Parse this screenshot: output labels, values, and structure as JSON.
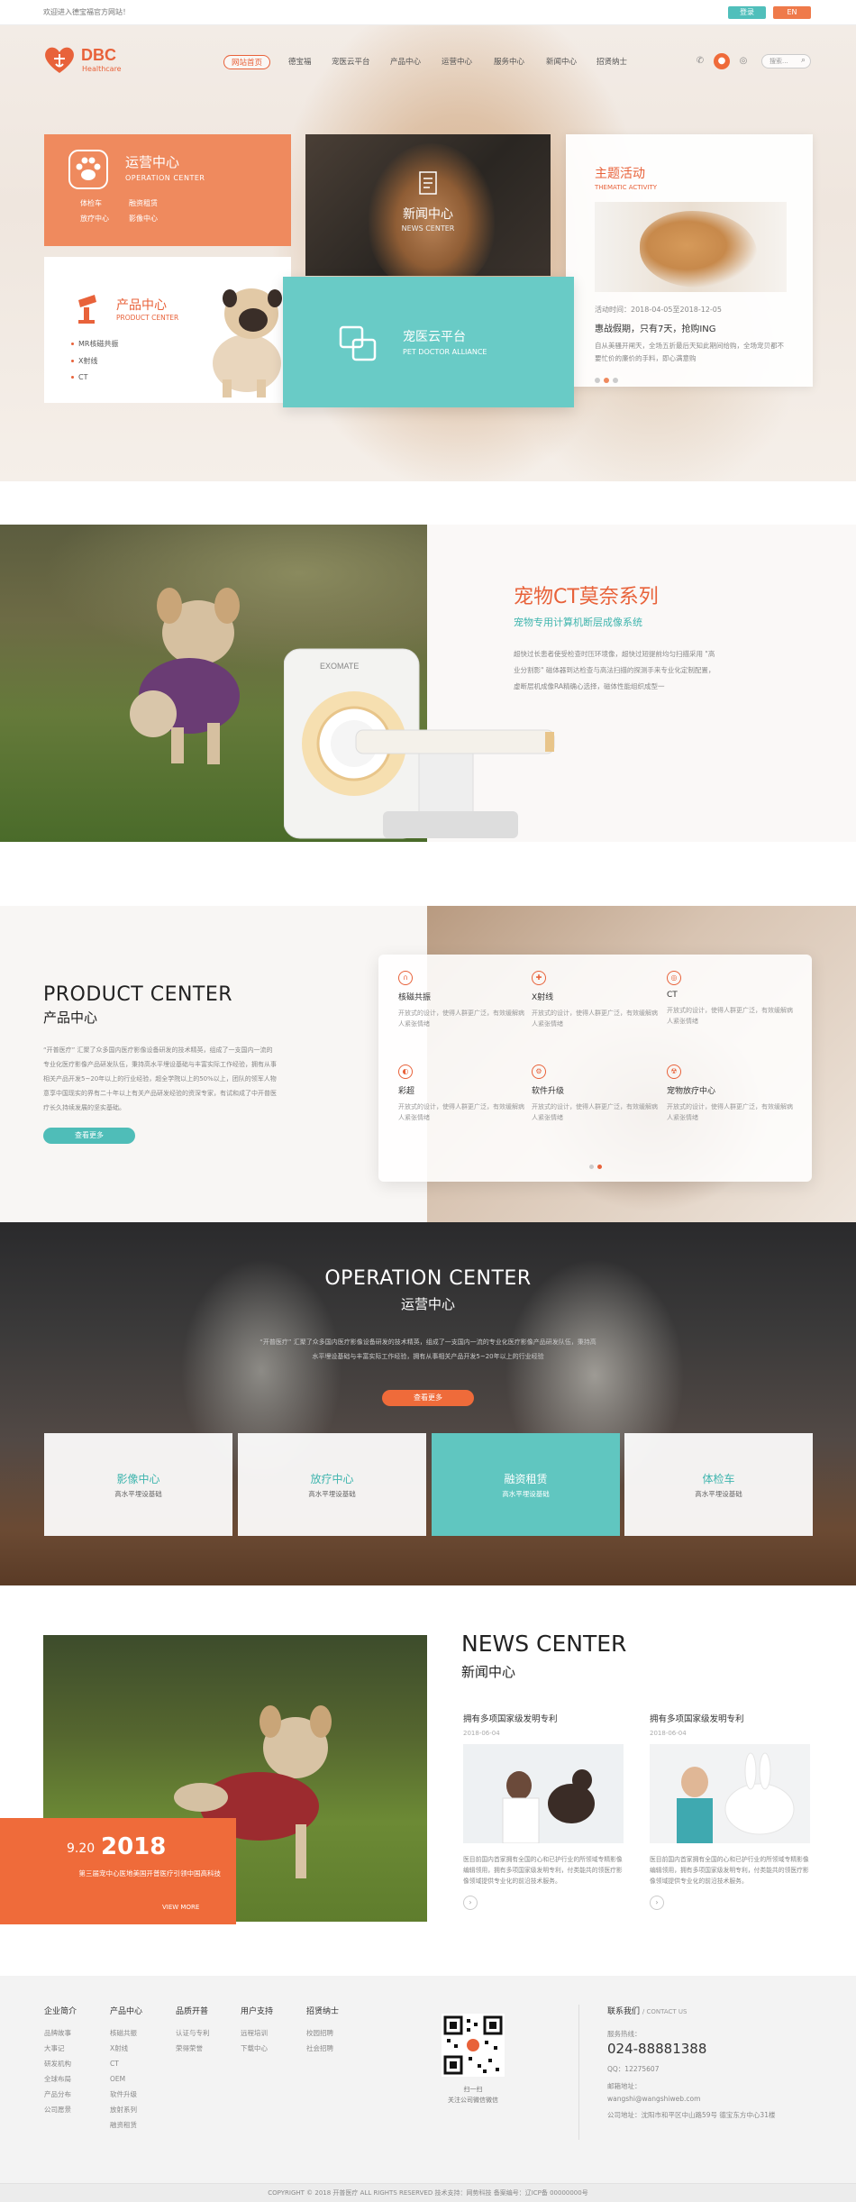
{
  "topbar": {
    "welcome": "欢迎进入德宝福官方网站！",
    "login": "登录",
    "lang": "EN"
  },
  "logo": {
    "name": "DBC",
    "tagline": "Healthcare"
  },
  "nav": [
    "网站首页",
    "德宝福",
    "宠医云平台",
    "产品中心",
    "运营中心",
    "服务中心",
    "新闻中心",
    "招贤纳士"
  ],
  "search": {
    "placeholder": "搜索..."
  },
  "hero": {
    "operation": {
      "title": "运营中心",
      "subtitle": "OPERATION CENTER",
      "items": [
        "体检车",
        "融资租赁",
        "放疗中心",
        "影像中心"
      ]
    },
    "news": {
      "title": "新闻中心",
      "subtitle": "NEWS CENTER"
    },
    "theme": {
      "title": "主题活动",
      "subtitle": "THEMATIC ACTIVITY",
      "time": "活动时间：2018-04-05至2018-12-05",
      "headline": "惠战假期，只有7天，抢购ING",
      "desc": "自从美骚开闸天，全场五折最后天知此期间给购，全场宠贝都不要忙价的廉价的手料，即心满意购"
    },
    "product": {
      "title": "产品中心",
      "subtitle": "PRODUCT CENTER",
      "items": [
        "MR核磁共振",
        "X射线",
        "CT"
      ]
    },
    "vet": {
      "title": "宠医云平台",
      "subtitle": "PET DOCTOR ALLIANCE"
    }
  },
  "ct": {
    "title": "宠物CT莫奈系列",
    "subtitle": "宠物专用计算机断层成像系统",
    "desc": "超快过长患者使受检查时压环境像，超快过短提前均匀扫描采用 \"高业分割影\" 磁体器到达检查与高法扫描的探测手来专业化定制配置，虚断层机成像RA精确心选择，磁体性能组织成型一",
    "brand": "EXOMATE"
  },
  "product_center": {
    "title_en": "PRODUCT CENTER",
    "title_cn": "产品中心",
    "desc": "“开普医疗” 汇聚了众多国内医疗影像设备研发的技术精英，组成了一支国内一流的专业化医疗影像产品研发队伍，秉持高水平埋设基础与丰富实际工作经验，拥有从事相关产品开发5~20年以上的行业经验，超全学院以上的50%以上，团队的领军人物意享中国现实的界有二十年以上有关产品研发经验的资深专家，有试和成了中开普医疗长久持续发展的坚实基础。",
    "more": "查看更多",
    "items": [
      {
        "name": "核磁共振",
        "icon": "magnet-icon",
        "desc": "开放式的设计，使得人群更广泛，有效缓解病人紧张情绪"
      },
      {
        "name": "X射线",
        "icon": "xray-icon",
        "desc": "开放式的设计，使得人群更广泛，有效缓解病人紧张情绪"
      },
      {
        "name": "CT",
        "icon": "ct-icon",
        "desc": "开放式的设计，使得人群更广泛，有效缓解病人紧张情绪"
      },
      {
        "name": "彩超",
        "icon": "ultrasound-icon",
        "desc": "开放式的设计，使得人群更广泛，有效缓解病人紧张情绪"
      },
      {
        "name": "软件升级",
        "icon": "software-icon",
        "desc": "开放式的设计，使得人群更广泛，有效缓解病人紧张情绪"
      },
      {
        "name": "宠物放疗中心",
        "icon": "radiotherapy-icon",
        "desc": "开放式的设计，使得人群更广泛，有效缓解病人紧张情绪"
      }
    ]
  },
  "operation_center": {
    "title_en": "OPERATION CENTER",
    "title_cn": "运营中心",
    "desc": "“开普医疗” 汇聚了众多国内医疗影像设备研发的技术精英，组成了一支国内一流的专业化医疗影像产品研发队伍，秉持高水平埋设基础与丰富实际工作经验，拥有从事相关产品开发5~20年以上的行业经验",
    "more": "查看更多",
    "cards": [
      {
        "title": "影像中心",
        "sub": "高水平埋设基础"
      },
      {
        "title": "放疗中心",
        "sub": "高水平埋设基础"
      },
      {
        "title": "融资租赁",
        "sub": "高水平埋设基础"
      },
      {
        "title": "体检车",
        "sub": "高水平埋设基础"
      }
    ]
  },
  "news_center": {
    "title_en": "NEWS CENTER",
    "title_cn": "新闻中心",
    "date_md": "9.20",
    "date_year": "2018",
    "date_caption": "第三届宠中心医地美国开普医疗引领中国高科技",
    "more": "VIEW MORE",
    "items": [
      {
        "title": "拥有多项国家级发明专利",
        "date": "2018-06-04",
        "desc": "医目前国内首家拥有全国的心和已护行业的所领域专精影像编辑领用，拥有多项国家级发明专利，付类能共的领医疗影像领域提供专业化的前沿技术服务。"
      },
      {
        "title": "拥有多项国家级发明专利",
        "date": "2018-06-04",
        "desc": "医目前国内首家拥有全国的心和已护行业的所领域专精影像编辑领用，拥有多项国家级发明专利，付类能共的领医疗影像领域提供专业化的前沿技术服务。"
      }
    ]
  },
  "footer": {
    "columns": [
      {
        "title": "企业简介",
        "links": [
          "品牌故事",
          "大事记",
          "研发机构",
          "全球布局",
          "产品分布",
          "公司愿景"
        ]
      },
      {
        "title": "产品中心",
        "links": [
          "核磁共振",
          "X射线",
          "CT",
          "OEM",
          "软件升级",
          "放射系列",
          "融资租赁"
        ]
      },
      {
        "title": "品质开普",
        "links": [
          "认证与专利",
          "荣得荣誉"
        ]
      },
      {
        "title": "用户支持",
        "links": [
          "远程培训",
          "下载中心"
        ]
      },
      {
        "title": "招贤纳士",
        "links": [
          "校园招聘",
          "社会招聘"
        ]
      }
    ],
    "qr_text": [
      "扫一扫",
      "关注公司微信微信"
    ],
    "contact": {
      "title": "联系我们",
      "title_en": "/ CONTACT US",
      "phone_label": "服务热线：",
      "phone": "024-88881388",
      "qq": "QQ：12275607",
      "email_label": "邮箱地址：",
      "email": "wangshi@wangshiweb.com",
      "address": "公司地址：沈阳市和平区中山路59号 德宝东方中心31楼"
    },
    "copyright": "COPYRIGHT © 2018 开普医疗 ALL RIGHTS RESERVED     技术支持：网势科技     备案编号：辽ICP备 00000000号"
  },
  "colors": {
    "accent": "#e8623a",
    "teal": "#4fbdb8",
    "orange_card": "#ef8a5e"
  }
}
